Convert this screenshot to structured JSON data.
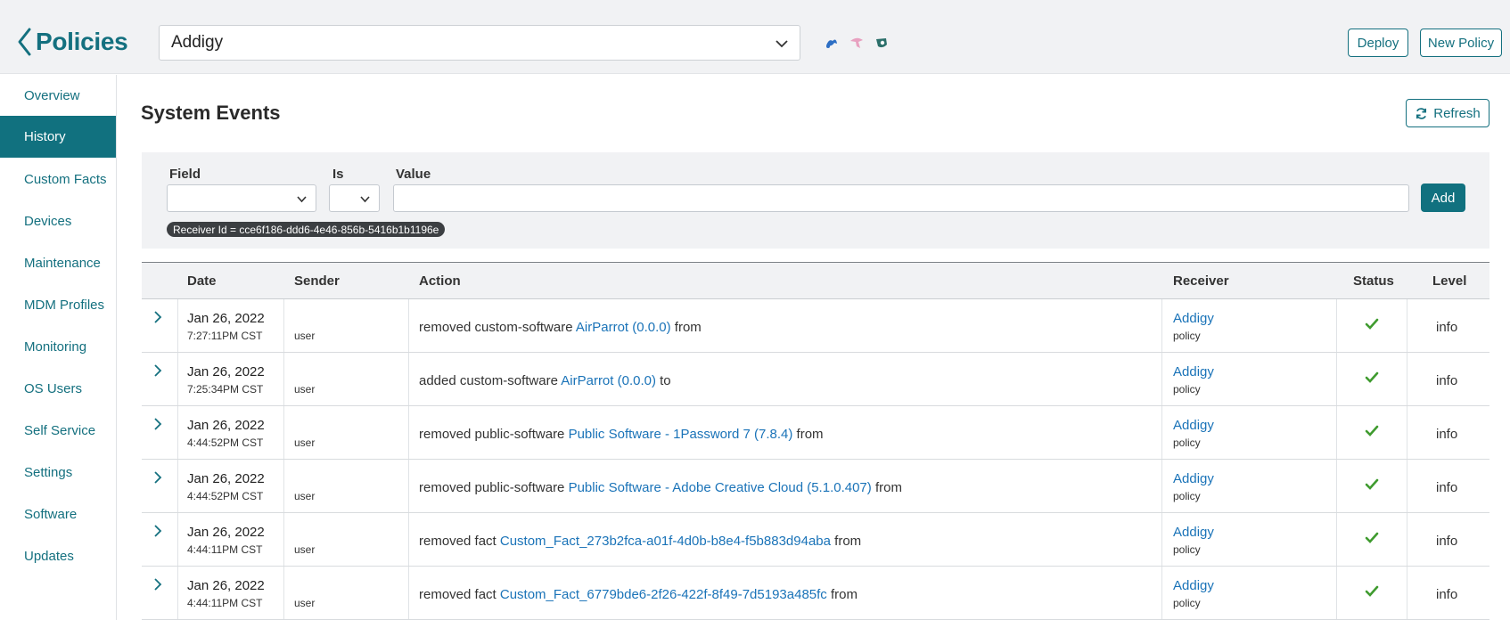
{
  "header": {
    "back_title": "Policies",
    "policy_select_value": "Addigy",
    "deploy_label": "Deploy",
    "new_policy_label": "New Policy",
    "os_icons": [
      "apple-icon",
      "ios-icon",
      "ipados-icon"
    ]
  },
  "sidebar": {
    "items": [
      {
        "label": "Overview",
        "active": false
      },
      {
        "label": "History",
        "active": true
      },
      {
        "label": "Custom Facts",
        "active": false
      },
      {
        "label": "Devices",
        "active": false
      },
      {
        "label": "Maintenance",
        "active": false
      },
      {
        "label": "MDM Profiles",
        "active": false
      },
      {
        "label": "Monitoring",
        "active": false
      },
      {
        "label": "OS Users",
        "active": false
      },
      {
        "label": "Self Service",
        "active": false
      },
      {
        "label": "Settings",
        "active": false
      },
      {
        "label": "Software",
        "active": false
      },
      {
        "label": "Updates",
        "active": false
      }
    ]
  },
  "main": {
    "title": "System Events",
    "refresh_label": "Refresh"
  },
  "filter": {
    "field_label": "Field",
    "is_label": "Is",
    "value_label": "Value",
    "field_value": "",
    "is_value": "",
    "value_input": "",
    "add_label": "Add",
    "chip": "Receiver Id = cce6f186-ddd6-4e46-856b-5416b1b1196e"
  },
  "table": {
    "columns": {
      "date": "Date",
      "sender": "Sender",
      "action": "Action",
      "receiver": "Receiver",
      "status": "Status",
      "level": "Level"
    },
    "rows": [
      {
        "date": "Jan 26, 2022",
        "time": "7:27:11PM CST",
        "sender": "user",
        "action_pre": "removed custom-software ",
        "action_link": "AirParrot (0.0.0)",
        "action_post": " from",
        "receiver": "Addigy",
        "receiver_type": "policy",
        "status": "success",
        "level": "info"
      },
      {
        "date": "Jan 26, 2022",
        "time": "7:25:34PM CST",
        "sender": "user",
        "action_pre": "added custom-software ",
        "action_link": "AirParrot (0.0.0)",
        "action_post": " to",
        "receiver": "Addigy",
        "receiver_type": "policy",
        "status": "success",
        "level": "info"
      },
      {
        "date": "Jan 26, 2022",
        "time": "4:44:52PM CST",
        "sender": "user",
        "action_pre": "removed public-software ",
        "action_link": "Public Software - 1Password 7 (7.8.4)",
        "action_post": " from",
        "receiver": "Addigy",
        "receiver_type": "policy",
        "status": "success",
        "level": "info"
      },
      {
        "date": "Jan 26, 2022",
        "time": "4:44:52PM CST",
        "sender": "user",
        "action_pre": "removed public-software ",
        "action_link": "Public Software - Adobe Creative Cloud (5.1.0.407)",
        "action_post": " from",
        "receiver": "Addigy",
        "receiver_type": "policy",
        "status": "success",
        "level": "info"
      },
      {
        "date": "Jan 26, 2022",
        "time": "4:44:11PM CST",
        "sender": "user",
        "action_pre": "removed fact ",
        "action_link": "Custom_Fact_273b2fca-a01f-4d0b-b8e4-f5b883d94aba",
        "action_post": " from",
        "receiver": "Addigy",
        "receiver_type": "policy",
        "status": "success",
        "level": "info"
      },
      {
        "date": "Jan 26, 2022",
        "time": "4:44:11PM CST",
        "sender": "user",
        "action_pre": "removed fact ",
        "action_link": "Custom_Fact_6779bde6-2f26-422f-8f49-7d5193a485fc",
        "action_post": " from",
        "receiver": "Addigy",
        "receiver_type": "policy",
        "status": "success",
        "level": "info"
      }
    ]
  },
  "colors": {
    "brand": "#14707f",
    "active_bg": "#11717f",
    "link": "#1a73b8",
    "success": "#3f9b2f"
  }
}
